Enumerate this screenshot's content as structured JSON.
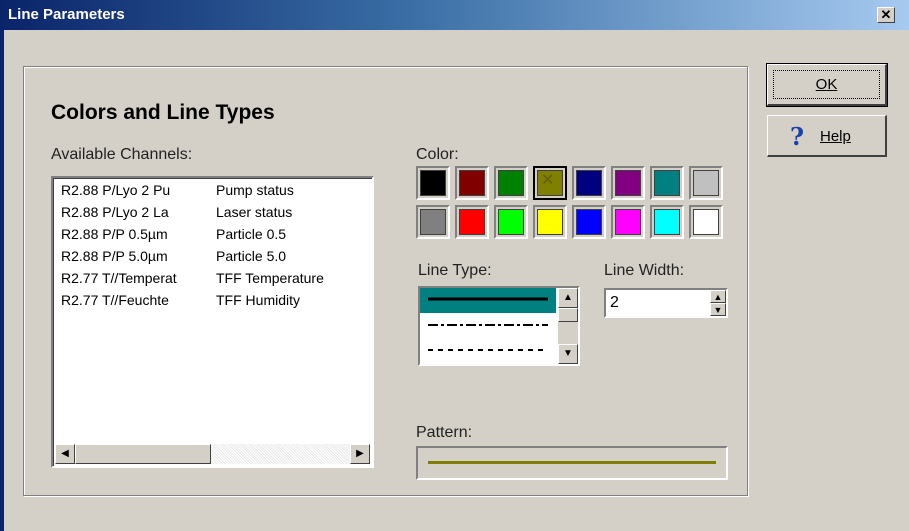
{
  "window": {
    "title": "Line Parameters",
    "close_glyph": "✕"
  },
  "group": {
    "heading": "Colors and Line Types"
  },
  "channels": {
    "label": "Available Channels:",
    "rows": [
      {
        "name": "R2.88 P/Lyo 2 Pu",
        "desc": "Pump status"
      },
      {
        "name": "R2.88 P/Lyo 2 La",
        "desc": "Laser status"
      },
      {
        "name": "R2.88 P/P 0.5µm",
        "desc": "Particle 0.5"
      },
      {
        "name": "R2.88 P/P 5.0µm",
        "desc": "Particle 5.0"
      },
      {
        "name": "R2.77 T//Temperat",
        "desc": "TFF Temperature"
      },
      {
        "name": "R2.77 T//Feuchte",
        "desc": "TFF Humidity"
      }
    ],
    "scroll_left": "◀",
    "scroll_right": "▶"
  },
  "color": {
    "label": "Color:",
    "swatches": [
      "#000000",
      "#800000",
      "#008000",
      "#808000",
      "#000080",
      "#800080",
      "#008080",
      "#c0c0c0",
      "#808080",
      "#ff0000",
      "#00ff00",
      "#ffff00",
      "#0000ff",
      "#ff00ff",
      "#00ffff",
      "#ffffff"
    ],
    "selected_index": 3,
    "selected_mark": "✕"
  },
  "line_type": {
    "label": "Line Type:",
    "options": [
      "solid",
      "dash-dot",
      "dashed"
    ],
    "selected_index": 0,
    "scroll_up": "▲",
    "scroll_down": "▼"
  },
  "line_width": {
    "label": "Line Width:",
    "value": "2",
    "up": "▲",
    "down": "▼"
  },
  "pattern": {
    "label": "Pattern:",
    "color": "#808000"
  },
  "buttons": {
    "ok": "OK",
    "help": "Help",
    "help_icon": "?"
  }
}
